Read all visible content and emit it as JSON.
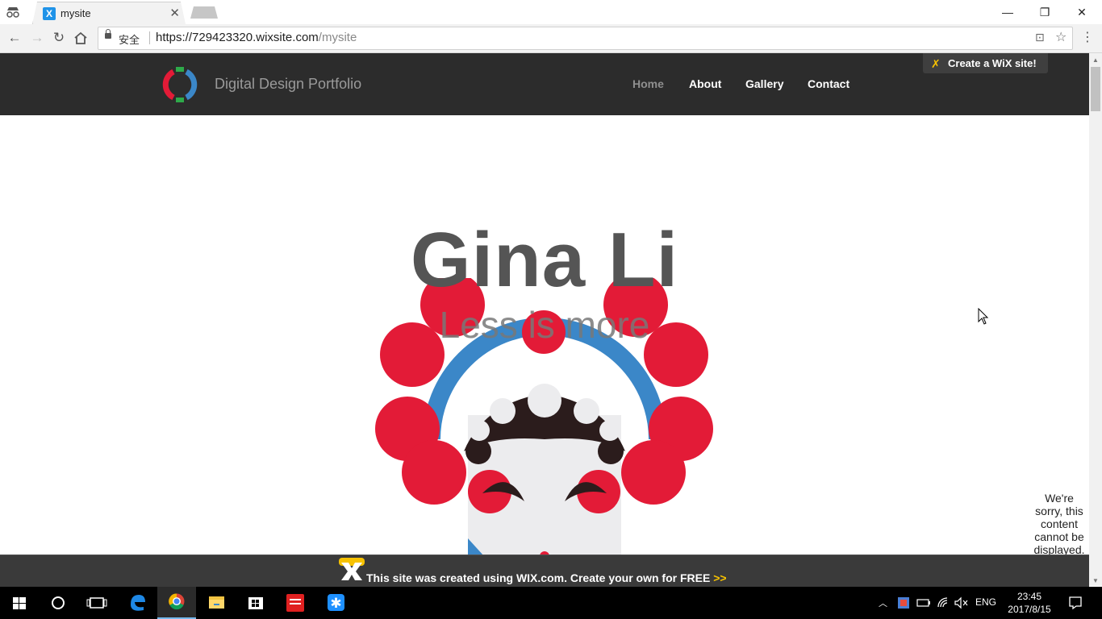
{
  "browser": {
    "tab_title": "mysite",
    "tab_favicon": "X",
    "secure_label": "安全",
    "url_host": "https://729423320.wixsite.com",
    "url_path": "/mysite"
  },
  "site": {
    "title": "Digital Design Portfolio",
    "nav": [
      "Home",
      "About",
      "Gallery",
      "Contact"
    ],
    "active_nav": "Home",
    "create_wix_label": "Create a WiX site!"
  },
  "hero": {
    "name": "Gina Li",
    "tagline": "Less is more"
  },
  "notice": "We're sorry, this content cannot be displayed.",
  "wix_banner": {
    "text": "This site was created using WIX.com. Create your own for FREE",
    "arrows": ">>"
  },
  "taskbar": {
    "language": "ENG",
    "time": "23:45",
    "date": "2017/8/15"
  },
  "colors": {
    "header_bg": "#2c2c2c",
    "opera_red": "#e31b37",
    "opera_blue": "#3b87c8",
    "wix_yellow": "#f7c200"
  }
}
